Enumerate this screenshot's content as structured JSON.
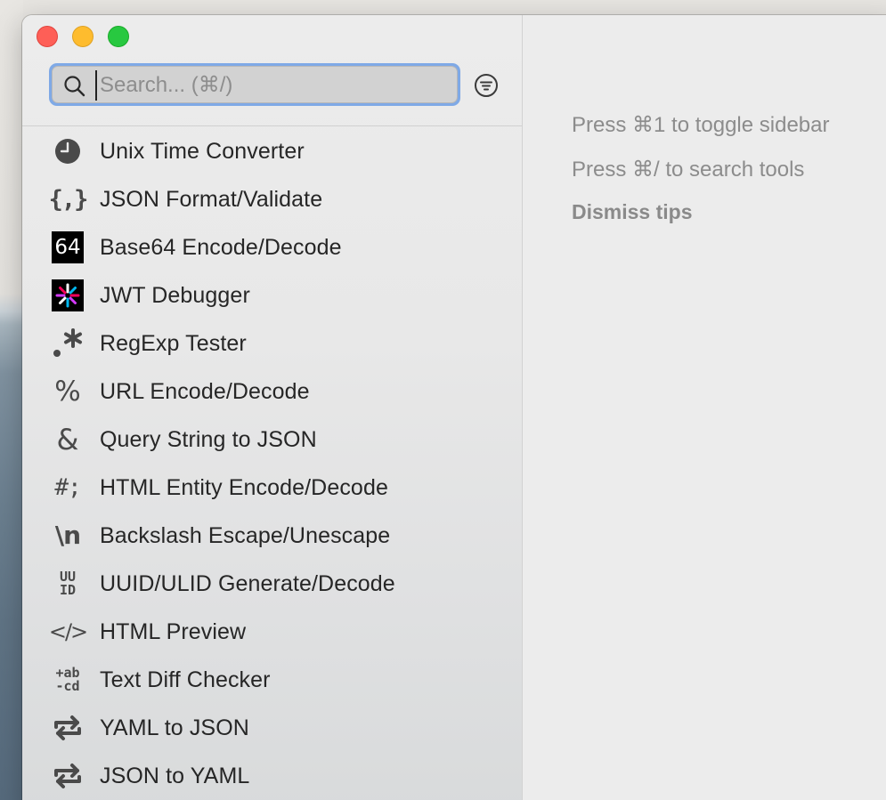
{
  "sidebar": {
    "search": {
      "placeholder": "Search... (⌘/)",
      "value": ""
    },
    "tools": [
      {
        "label": "Unix Time Converter",
        "icon": "clock-icon"
      },
      {
        "label": "JSON Format/Validate",
        "icon": "json-braces-icon",
        "glyph": "{,}"
      },
      {
        "label": "Base64 Encode/Decode",
        "icon": "base64-icon",
        "glyph": "64"
      },
      {
        "label": "JWT Debugger",
        "icon": "jwt-icon"
      },
      {
        "label": "RegExp Tester",
        "icon": "regexp-icon",
        "glyph": ".*"
      },
      {
        "label": "URL Encode/Decode",
        "icon": "percent-icon",
        "glyph": "%"
      },
      {
        "label": "Query String to JSON",
        "icon": "ampersand-icon",
        "glyph": "&"
      },
      {
        "label": "HTML Entity Encode/Decode",
        "icon": "html-entity-icon",
        "glyph": "#;"
      },
      {
        "label": "Backslash Escape/Unescape",
        "icon": "backslash-n-icon",
        "glyph": "\\n"
      },
      {
        "label": "UUID/ULID Generate/Decode",
        "icon": "uuid-icon",
        "glyph_top": "UU",
        "glyph_bottom": "ID"
      },
      {
        "label": "HTML Preview",
        "icon": "code-brackets-icon",
        "glyph": "</>"
      },
      {
        "label": "Text Diff Checker",
        "icon": "text-diff-icon",
        "glyph_top": "+ab",
        "glyph_bottom": "-cd"
      },
      {
        "label": "YAML to JSON",
        "icon": "convert-arrows-icon"
      },
      {
        "label": "JSON to YAML",
        "icon": "convert-arrows-icon"
      }
    ]
  },
  "main": {
    "tips": [
      "Press ⌘1 to toggle sidebar",
      "Press ⌘/ to search tools"
    ],
    "dismiss_label": "Dismiss tips"
  },
  "colors": {
    "close": "#fe5f57",
    "minimize": "#febc2e",
    "maximize": "#28c840",
    "focus_ring": "#7fa9e6"
  }
}
